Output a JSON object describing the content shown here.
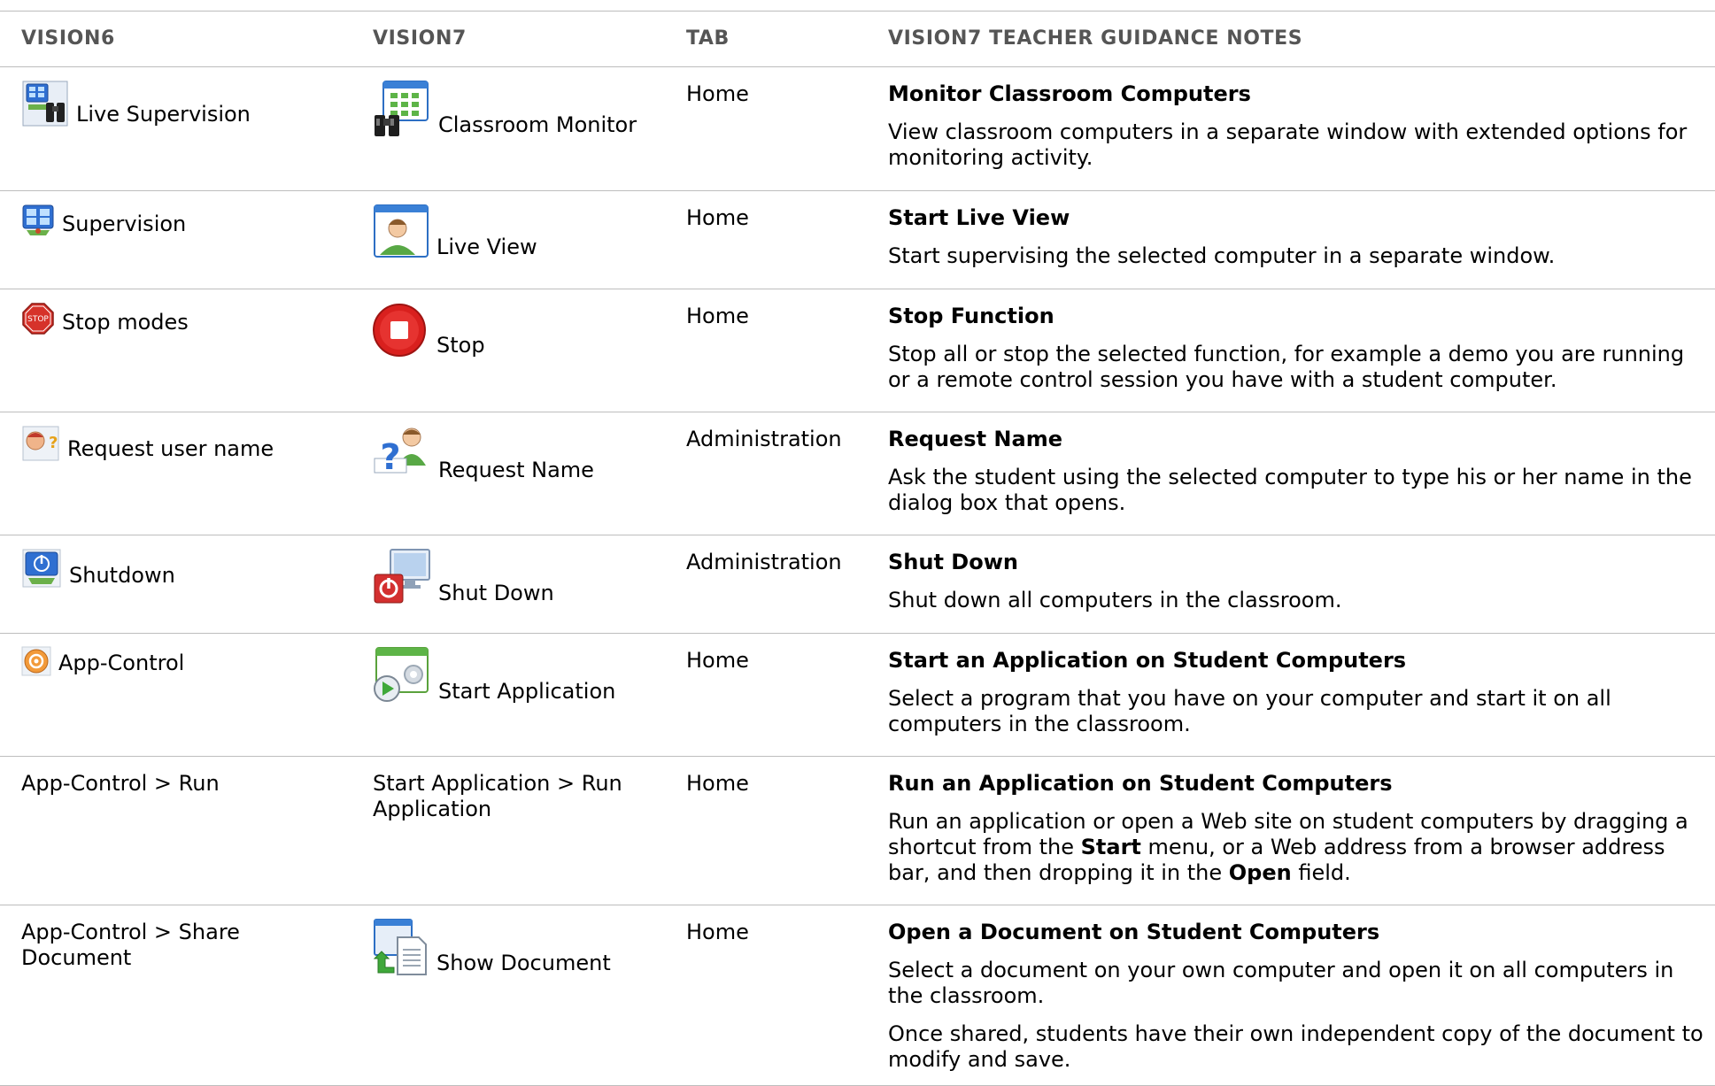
{
  "header": {
    "col1": "VISION6",
    "col2": "VISION7",
    "col3": "TAB",
    "col4": "VISION7 TEACHER GUIDANCE NOTES"
  },
  "rows": [
    {
      "v6": {
        "label": "Live Supervision",
        "icon": "live-supervision-icon"
      },
      "v7": {
        "label": "Classroom Monitor",
        "icon": "classroom-monitor-icon"
      },
      "tab": "Home",
      "title": "Monitor Classroom Computers",
      "notes": [
        "View classroom computers in a separate window with extended options for monitoring activity."
      ]
    },
    {
      "v6": {
        "label": "Supervision",
        "icon": "supervision-icon"
      },
      "v7": {
        "label": "Live View",
        "icon": "live-view-icon"
      },
      "tab": "Home",
      "title": "Start Live View",
      "notes": [
        "Start supervising the selected computer in a separate window."
      ]
    },
    {
      "v6": {
        "label": "Stop modes",
        "icon": "stop-sign-icon",
        "icon_text": "STOP"
      },
      "v7": {
        "label": "Stop",
        "icon": "stop-icon"
      },
      "tab": "Home",
      "title": "Stop Function",
      "notes": [
        "Stop all or stop the selected function, for example a demo you are running or a remote control session you have with a student computer."
      ]
    },
    {
      "v6": {
        "label": "Request user name",
        "icon": "request-user-name-icon"
      },
      "v7": {
        "label": "Request Name",
        "icon": "request-name-icon"
      },
      "tab": "Administration",
      "title": "Request Name",
      "notes": [
        "Ask the student using the selected computer to type his or her name in the dialog box that opens."
      ]
    },
    {
      "v6": {
        "label": "Shutdown",
        "icon": "shutdown-icon"
      },
      "v7": {
        "label": "Shut Down",
        "icon": "shut-down-icon"
      },
      "tab": "Administration",
      "title": "Shut Down",
      "notes": [
        "Shut down all computers in the classroom."
      ]
    },
    {
      "v6": {
        "label": "App-Control",
        "icon": "app-control-icon"
      },
      "v7": {
        "label": "Start Application",
        "icon": "start-application-icon"
      },
      "tab": "Home",
      "title": "Start an Application on Student Computers",
      "notes": [
        "Select a program that you have on your computer and start it on all computers in the classroom."
      ]
    },
    {
      "v6": {
        "label": "App-Control > Run"
      },
      "v7": {
        "label": "Start Application > Run Application"
      },
      "tab": "Home",
      "title": "Run an Application on Student Computers",
      "note_rich": {
        "t1": "Run an application or open a Web site on student computers by dragging a shortcut from the ",
        "b1": "Start",
        "t2": " menu, or a Web address from a browser address bar, and then dropping it in the ",
        "b2": "Open",
        "t3": " field."
      }
    },
    {
      "v6": {
        "label": "App-Control > Share Document"
      },
      "v7": {
        "label": "Show Document",
        "icon": "show-document-icon"
      },
      "tab": "Home",
      "title": "Open a Document on Student Computers",
      "notes": [
        "Select a document on your own computer and open it on all computers in the classroom.",
        "Once shared, students have their own independent copy of the document to modify and save."
      ]
    }
  ]
}
